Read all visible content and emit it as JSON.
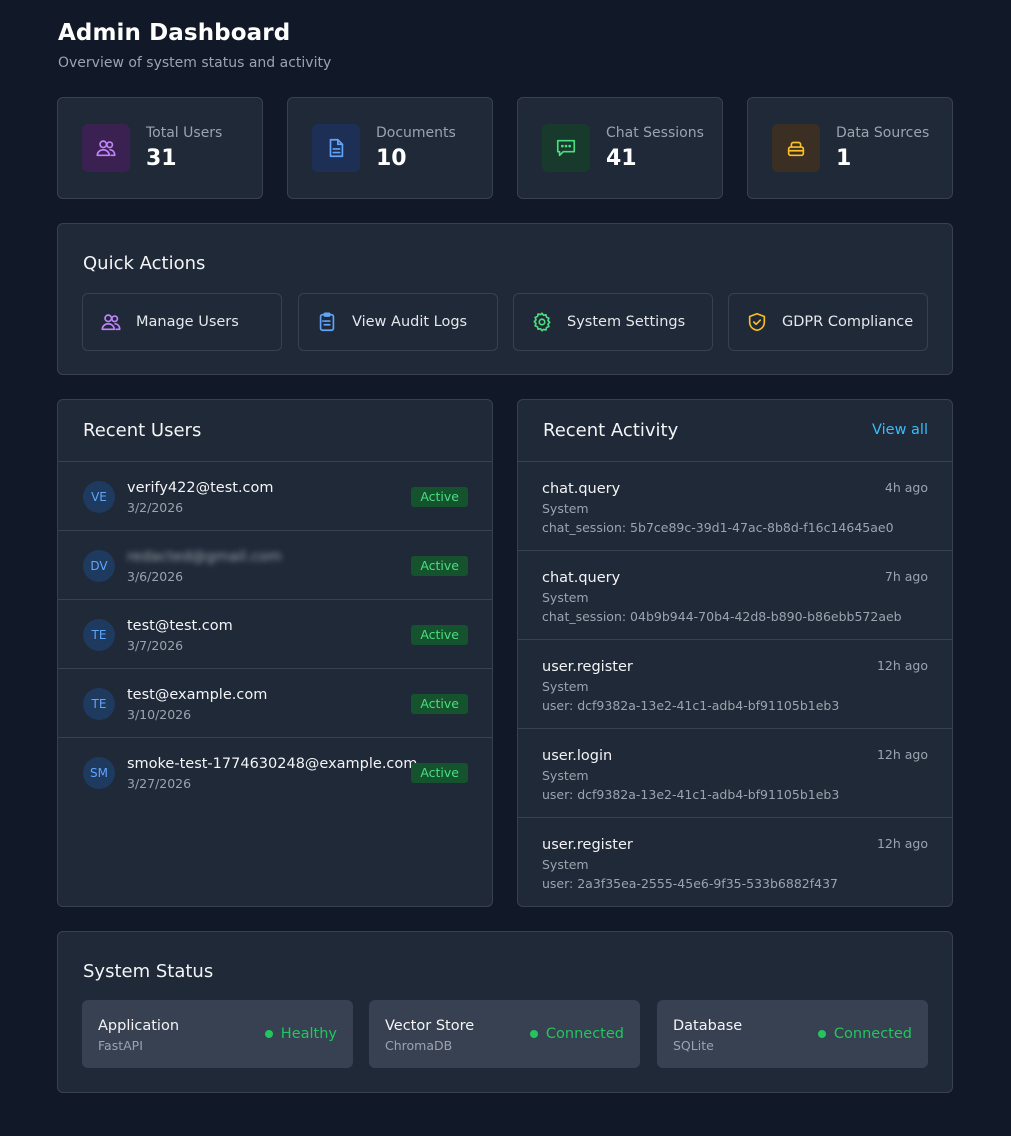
{
  "header": {
    "title": "Admin Dashboard",
    "subtitle": "Overview of system status and activity"
  },
  "stats": [
    {
      "label": "Total Users",
      "value": "31",
      "icon": "users-icon",
      "color": "#c084fc",
      "bg": "#3b2152"
    },
    {
      "label": "Documents",
      "value": "10",
      "icon": "document-icon",
      "color": "#60a5fa",
      "bg": "#1e2f55"
    },
    {
      "label": "Chat Sessions",
      "value": "41",
      "icon": "chat-icon",
      "color": "#4ade80",
      "bg": "#173a2c"
    },
    {
      "label": "Data Sources",
      "value": "1",
      "icon": "database-icon",
      "color": "#fbbf24",
      "bg": "#3a2f22"
    }
  ],
  "quick_actions": {
    "title": "Quick Actions",
    "items": [
      {
        "label": "Manage Users",
        "icon": "users-icon",
        "color": "#c084fc"
      },
      {
        "label": "View Audit Logs",
        "icon": "clipboard-icon",
        "color": "#60a5fa"
      },
      {
        "label": "System Settings",
        "icon": "gear-icon",
        "color": "#4ade80"
      },
      {
        "label": "GDPR Compliance",
        "icon": "shield-check-icon",
        "color": "#fbbf24"
      }
    ]
  },
  "recent_users": {
    "title": "Recent Users",
    "rows": [
      {
        "initials": "VE",
        "email": "verify422@test.com",
        "date": "3/2/2026",
        "status": "Active",
        "blurred": false
      },
      {
        "initials": "DV",
        "email": "redacted@gmail.com",
        "date": "3/6/2026",
        "status": "Active",
        "blurred": true
      },
      {
        "initials": "TE",
        "email": "test@test.com",
        "date": "3/7/2026",
        "status": "Active",
        "blurred": false
      },
      {
        "initials": "TE",
        "email": "test@example.com",
        "date": "3/10/2026",
        "status": "Active",
        "blurred": false
      },
      {
        "initials": "SM",
        "email": "smoke-test-1774630248@example.com",
        "date": "3/27/2026",
        "status": "Active",
        "blurred": false
      }
    ]
  },
  "recent_activity": {
    "title": "Recent Activity",
    "view_all": "View all",
    "rows": [
      {
        "action": "chat.query",
        "actor": "System",
        "target": "chat_session: 5b7ce89c-39d1-47ac-8b8d-f16c14645ae0",
        "time": "4h ago"
      },
      {
        "action": "chat.query",
        "actor": "System",
        "target": "chat_session: 04b9b944-70b4-42d8-b890-b86ebb572aeb",
        "time": "7h ago"
      },
      {
        "action": "user.register",
        "actor": "System",
        "target": "user: dcf9382a-13e2-41c1-adb4-bf91105b1eb3",
        "time": "12h ago"
      },
      {
        "action": "user.login",
        "actor": "System",
        "target": "user: dcf9382a-13e2-41c1-adb4-bf91105b1eb3",
        "time": "12h ago"
      },
      {
        "action": "user.register",
        "actor": "System",
        "target": "user: 2a3f35ea-2555-45e6-9f35-533b6882f437",
        "time": "12h ago"
      }
    ]
  },
  "system_status": {
    "title": "System Status",
    "items": [
      {
        "name": "Application",
        "sub": "FastAPI",
        "state": "Healthy"
      },
      {
        "name": "Vector Store",
        "sub": "ChromaDB",
        "state": "Connected"
      },
      {
        "name": "Database",
        "sub": "SQLite",
        "state": "Connected"
      }
    ]
  }
}
